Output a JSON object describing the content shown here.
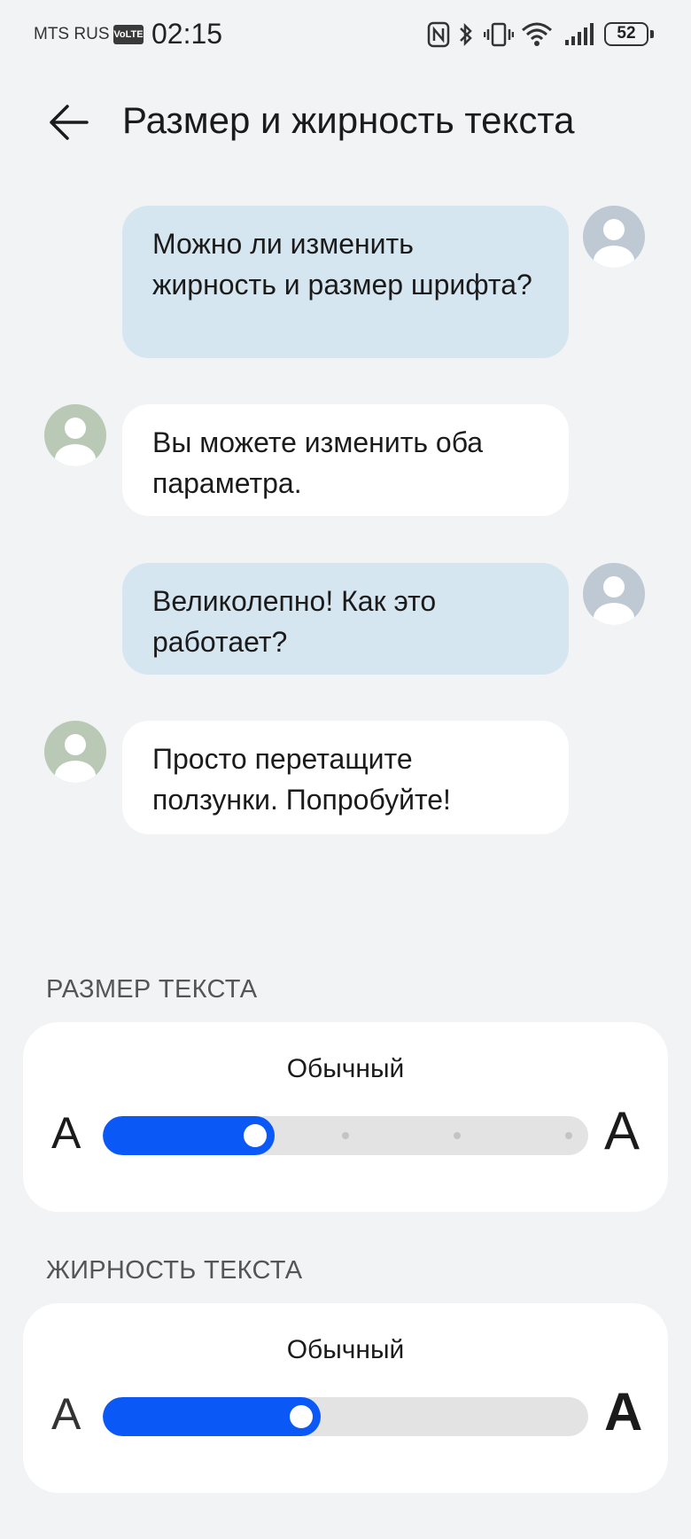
{
  "status_bar": {
    "carrier": "MTS RUS",
    "volte": "VoLTE",
    "time": "02:15",
    "battery": "52"
  },
  "header": {
    "back_icon": "arrow-left-icon",
    "title": "Размер и жирность текста"
  },
  "chat": {
    "messages": [
      {
        "sender": "user",
        "text": "Можно ли изменить жирность и размер шрифта?"
      },
      {
        "sender": "other",
        "text": "Вы можете изменить оба параметра."
      },
      {
        "sender": "user",
        "text": "Великолепно! Как это работает?"
      },
      {
        "sender": "other",
        "text": "Просто перетащите ползунки. Попробуйте!"
      }
    ]
  },
  "text_size": {
    "section_label": "РАЗМЕР ТЕКСТА",
    "value": "Обычный",
    "small_glyph": "A",
    "large_glyph": "A",
    "slider": {
      "steps": 5,
      "selected_index": 1
    }
  },
  "text_weight": {
    "section_label": "ЖИРНОСТЬ ТЕКСТА",
    "value": "Обычный",
    "small_glyph": "A",
    "large_glyph": "A",
    "slider": {
      "value_fraction": 0.4
    }
  },
  "colors": {
    "accent": "#0a59f7",
    "sent_bubble": "#d6e6f0",
    "received_bubble": "#ffffff",
    "background": "#f1f3f5",
    "user_avatar": "#bfc9d3",
    "other_avatar": "#b9c9b5"
  }
}
